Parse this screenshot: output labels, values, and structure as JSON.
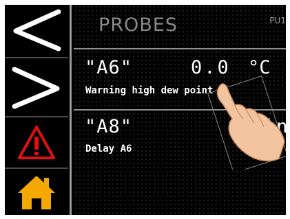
{
  "header": {
    "title": "PROBES",
    "code": "PU1"
  },
  "sidebar": {
    "buttons": [
      {
        "name": "prev-button",
        "icon": "chevron-left-icon"
      },
      {
        "name": "next-button",
        "icon": "chevron-right-icon"
      },
      {
        "name": "alarm-button",
        "icon": "warning-icon",
        "color": "#e01010"
      },
      {
        "name": "home-button",
        "icon": "home-icon",
        "color": "#f5a800"
      }
    ]
  },
  "probes": [
    {
      "name": "\"A6\"",
      "value": "0.0",
      "unit": "°C",
      "status": "Warning high dew point"
    },
    {
      "name": "\"A8\"",
      "value_fragment": "in",
      "status": "Delay A6"
    }
  ],
  "overlay": {
    "icon": "hand-pointer-icon"
  },
  "colors": {
    "background": "#000000",
    "text": "#ffffff",
    "title": "#8a8a8a",
    "warning": "#e01010",
    "home": "#f5a800"
  }
}
